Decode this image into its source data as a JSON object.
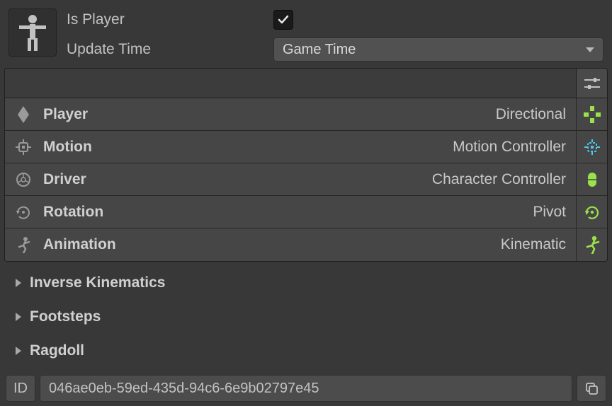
{
  "header": {
    "is_player_label": "Is Player",
    "is_player_checked": true,
    "update_time_label": "Update Time",
    "update_time_value": "Game Time"
  },
  "sections": [
    {
      "icon": "diamond-icon",
      "label": "Player",
      "value": "Directional",
      "action_color": "#9be24a"
    },
    {
      "icon": "chip-icon",
      "label": "Motion",
      "value": "Motion Controller",
      "action_color": "#4fc8e8"
    },
    {
      "icon": "wheel-icon",
      "label": "Driver",
      "value": "Character Controller",
      "action_color": "#9be24a"
    },
    {
      "icon": "rotate-icon",
      "label": "Rotation",
      "value": "Pivot",
      "action_color": "#9be24a"
    },
    {
      "icon": "run-icon",
      "label": "Animation",
      "value": "Kinematic",
      "action_color": "#9be24a"
    }
  ],
  "foldouts": [
    {
      "label": "Inverse Kinematics"
    },
    {
      "label": "Footsteps"
    },
    {
      "label": "Ragdoll"
    }
  ],
  "id": {
    "label": "ID",
    "value": "046ae0eb-59ed-435d-94c6-6e9b02797e45"
  }
}
